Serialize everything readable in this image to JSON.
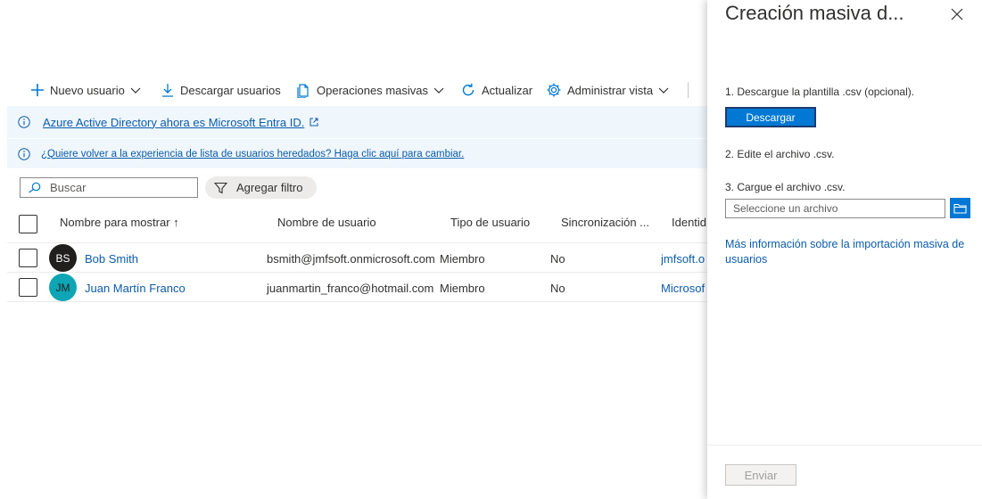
{
  "toolbar": {
    "new_user": "Nuevo usuario",
    "download_users": "Descargar usuarios",
    "bulk_operations": "Operaciones masivas",
    "refresh": "Actualizar",
    "manage_view": "Administrar vista"
  },
  "banners": {
    "entra_notice": "Azure Active Directory ahora es Microsoft Entra ID.",
    "legacy_notice": "¿Quiere volver a la experiencia de lista de usuarios heredados? Haga clic aquí para cambiar."
  },
  "search": {
    "placeholder": "Buscar"
  },
  "filter": {
    "label": "Agregar filtro"
  },
  "table": {
    "columns": [
      "Nombre para mostrar ↑",
      "Nombre de usuario",
      "Tipo de usuario",
      "Sincronización ...",
      "Identid"
    ],
    "rows": [
      {
        "initials": "BS",
        "avatar_color": "#201f1e",
        "avatar_text_color": "#ffffff",
        "name": "Bob Smith",
        "username": "bsmith@jmfsoft.onmicrosoft.com",
        "type": "Miembro",
        "sync": "No",
        "identity": "jmfsoft.o"
      },
      {
        "initials": "JM",
        "avatar_color": "#0ea5b5",
        "avatar_text_color": "#201f1e",
        "name": "Juan Martín Franco",
        "username": "juanmartin_franco@hotmail.com",
        "type": "Miembro",
        "sync": "No",
        "identity": "Microsof"
      }
    ]
  },
  "panel": {
    "title": "Creación masiva d...",
    "step1": "1. Descargue la plantilla .csv (opcional).",
    "download_button": "Descargar",
    "step2": "2. Edite el archivo .csv.",
    "step3": "3. Cargue el archivo .csv.",
    "file_placeholder": "Seleccione un archivo",
    "more_info": "Más información sobre la importación masiva de usuarios",
    "submit": "Enviar"
  },
  "colors": {
    "accent": "#0078d4",
    "link": "#0b5cad",
    "banner_bg": "#eff6fc"
  }
}
